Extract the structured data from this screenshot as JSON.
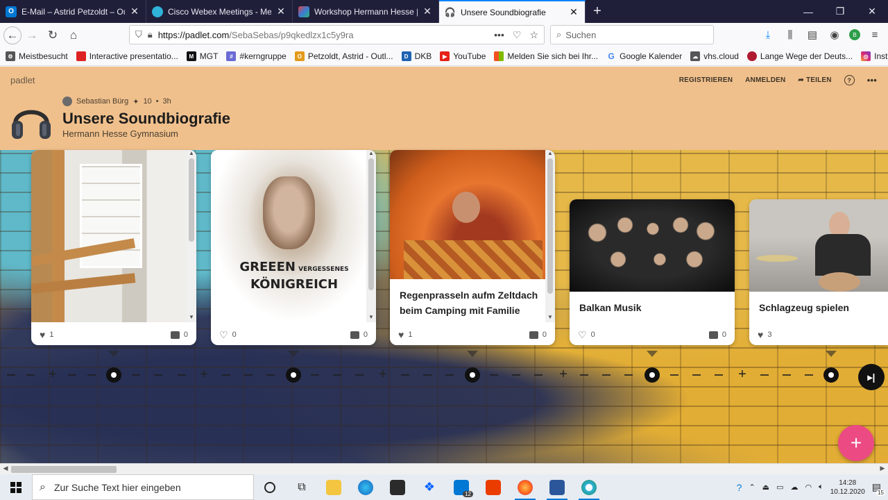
{
  "browser": {
    "tabs": [
      {
        "title": "E-Mail – Astrid Petzoldt – Outlo",
        "icon": "outlook-icon",
        "color": "#0078d4",
        "glyph": "O",
        "active": false
      },
      {
        "title": "Cisco Webex Meetings - Meeti",
        "icon": "webex-icon",
        "color": "#2fb3d9",
        "glyph": "",
        "active": false
      },
      {
        "title": "Workshop Hermann Hesse | bo",
        "icon": "board-icon",
        "color": "#7a3bd0",
        "glyph": "",
        "active": false
      },
      {
        "title": "Unsere Soundbiografie",
        "icon": "headphones-icon",
        "color": "#333333",
        "glyph": "",
        "active": true
      }
    ],
    "new_tab": "+",
    "url_host": "https://padlet.com",
    "url_path": "/SebaSebas/p9qkedlzx1c5y9ra",
    "search_placeholder": "Suchen",
    "bookmarks": [
      {
        "label": "Meistbesucht",
        "color": "#555555",
        "glyph": "⚙"
      },
      {
        "label": "Interactive presentatio...",
        "color": "#d22",
        "glyph": "▮"
      },
      {
        "label": "MGT",
        "color": "#111111",
        "glyph": "M"
      },
      {
        "label": "#kerngruppe",
        "color": "#6b6bd6",
        "glyph": "#"
      },
      {
        "label": "Petzoldt, Astrid - Outl...",
        "color": "#e39a1c",
        "glyph": "O"
      },
      {
        "label": "DKB",
        "color": "#1f63b2",
        "glyph": "D"
      },
      {
        "label": "YouTube",
        "color": "#e62117",
        "glyph": "▶"
      },
      {
        "label": "Melden Sie sich bei Ihr...",
        "color": "#f25022",
        "glyph": "■"
      },
      {
        "label": "Google Kalender",
        "color": "#4285f4",
        "glyph": "G"
      },
      {
        "label": "vhs.cloud",
        "color": "#555555",
        "glyph": "☁"
      },
      {
        "label": "Lange Wege der Deuts...",
        "color": "#b01a30",
        "glyph": "●"
      },
      {
        "label": "Instagram",
        "color": "#d62976",
        "glyph": "◎"
      }
    ]
  },
  "padlet": {
    "brand": "padlet",
    "actions": [
      "REGISTRIEREN",
      "ANMELDEN",
      "TEILEN"
    ],
    "author": "Sebastian Bürg",
    "likes": "10",
    "age": "3h",
    "title": "Unsere Soundbiografie",
    "subtitle": "Hermann Hesse Gymnasium",
    "cards": [
      {
        "title": "",
        "likes": "1",
        "comments": "0",
        "image": "spiral-staircase"
      },
      {
        "title": "",
        "likes": "0",
        "comments": "0",
        "image": "green-album-cover",
        "overlay_line1": "GREEEN",
        "overlay_line2": "VERGESSENES",
        "overlay_line3": "KÖNIGREICH"
      },
      {
        "title": "Regenprasseln aufm Zeltdach beim Camping mit Familie",
        "likes": "1",
        "comments": "0",
        "image": "tent-camping"
      },
      {
        "title": "Balkan Musik",
        "likes": "0",
        "comments": "0",
        "image": "balkan-band"
      },
      {
        "title": "Schlagzeug spielen",
        "likes": "3",
        "comments": "",
        "image": "drummer"
      }
    ]
  },
  "taskbar": {
    "search_placeholder": "Zur Suche Text hier eingeben",
    "time": "14:28",
    "date": "10.12.2020",
    "notifications": "15",
    "mail_badge": "12"
  },
  "colors": {
    "header_bg": "#f0c08c",
    "fab": "#ec4a83",
    "tab_active_accent": "#0a84ff"
  }
}
